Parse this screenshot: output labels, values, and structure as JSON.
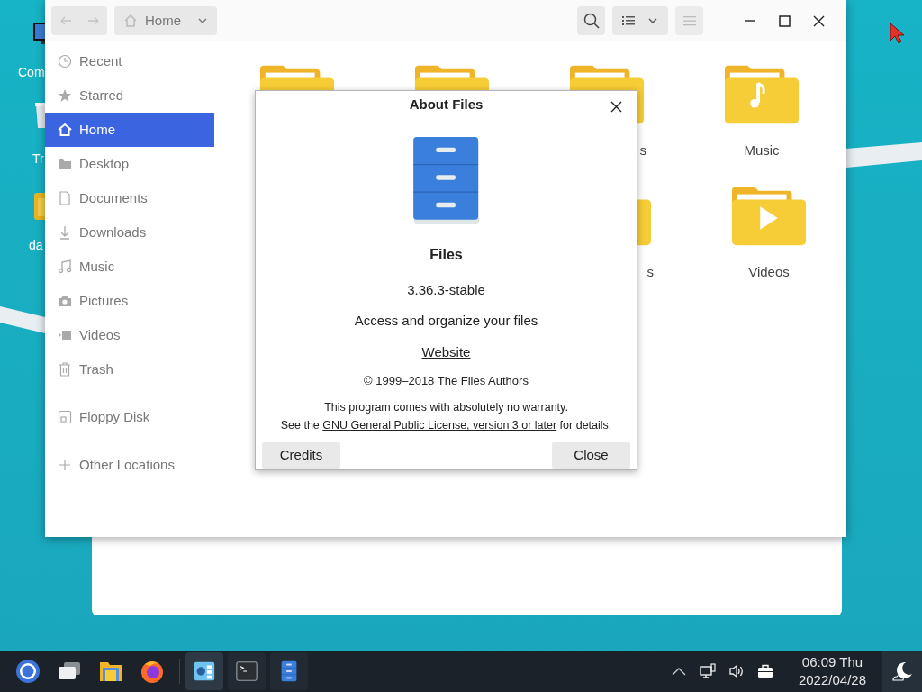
{
  "desktop": {
    "icons": [
      {
        "kind": "computer",
        "label": "Com"
      },
      {
        "kind": "trash",
        "label": "Tr"
      },
      {
        "kind": "folder",
        "label": "da"
      }
    ]
  },
  "files_window": {
    "nav": [
      {
        "kind": "back",
        "disabled": true
      },
      {
        "kind": "forward",
        "disabled": true
      }
    ],
    "path": "Home",
    "sidebar": {
      "sections": [
        [
          {
            "kind": "clock",
            "label": "Recent",
            "selected": false
          },
          {
            "kind": "star",
            "label": "Starred",
            "selected": false
          },
          {
            "kind": "home",
            "label": "Home",
            "selected": true
          },
          {
            "kind": "folder",
            "label": "Desktop",
            "selected": false
          },
          {
            "kind": "document",
            "label": "Documents",
            "selected": false
          },
          {
            "kind": "download",
            "label": "Downloads",
            "selected": false
          },
          {
            "kind": "music",
            "label": "Music",
            "selected": false
          },
          {
            "kind": "camera",
            "label": "Pictures",
            "selected": false
          },
          {
            "kind": "video",
            "label": "Videos",
            "selected": false
          },
          {
            "kind": "trash",
            "label": "Trash",
            "selected": false
          }
        ],
        [
          {
            "kind": "floppy",
            "label": "Floppy Disk",
            "selected": false
          }
        ],
        [
          {
            "kind": "plus",
            "label": "Other Locations",
            "selected": false
          }
        ]
      ]
    },
    "folder_rows": [
      [
        {
          "kind": "plain"
        },
        {
          "kind": "plain"
        },
        {
          "kind": "plain",
          "label": "s",
          "truncated": true
        },
        {
          "kind": "music",
          "label": "Music",
          "truncated": false
        }
      ],
      [
        {
          "kind": "plain",
          "label": "s",
          "truncated": true
        },
        {
          "kind": "video",
          "label": "Videos",
          "truncated": false
        }
      ]
    ]
  },
  "about_dialog": {
    "title": "About Files",
    "name": "Files",
    "version": "3.36.3-stable",
    "description": "Access and organize your files",
    "website": "Website",
    "copyright": "© 1999–2018 The Files Authors",
    "warranty": "This program comes with absolutely no warranty.",
    "license": {
      "before": "See the ",
      "link": "GNU General Public License, version 3 or later",
      "after": " for details."
    },
    "buttons": [
      "Credits",
      "Close"
    ]
  },
  "taskbar": {
    "pinned": [
      {
        "kind": "launcher"
      },
      {
        "kind": "windows"
      },
      {
        "kind": "files"
      },
      {
        "kind": "firefox"
      }
    ],
    "running": [
      {
        "kind": "settings",
        "selected": true
      },
      {
        "kind": "terminal",
        "selected": false
      },
      {
        "kind": "cabinet",
        "selected": false
      }
    ],
    "time": "06:09 Thu",
    "date": "2022/04/28"
  }
}
